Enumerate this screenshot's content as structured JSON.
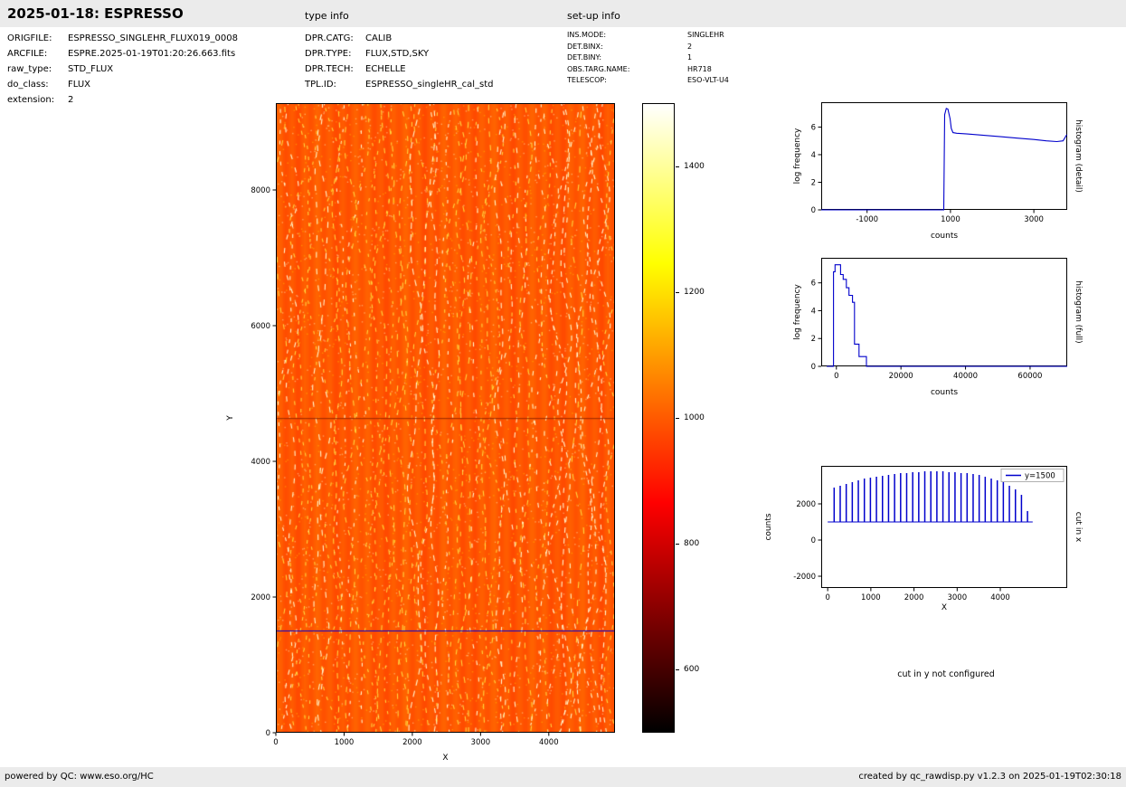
{
  "header": {
    "title": "2025-01-18: ESPRESSO",
    "type_info_heading": "type info",
    "setup_info_heading": "set-up info"
  },
  "file_info": {
    "rows": [
      {
        "label": "ORIGFILE:",
        "value": "ESPRESSO_SINGLEHR_FLUX019_0008"
      },
      {
        "label": "ARCFILE:",
        "value": "ESPRE.2025-01-19T01:20:26.663.fits"
      },
      {
        "label": "raw_type:",
        "value": "STD_FLUX"
      },
      {
        "label": "do_class:",
        "value": "FLUX"
      },
      {
        "label": "extension:",
        "value": "2"
      }
    ]
  },
  "type_info": {
    "rows": [
      {
        "label": "DPR.CATG:",
        "value": "CALIB"
      },
      {
        "label": "DPR.TYPE:",
        "value": "FLUX,STD,SKY"
      },
      {
        "label": "DPR.TECH:",
        "value": "ECHELLE"
      },
      {
        "label": "TPL.ID:",
        "value": "ESPRESSO_singleHR_cal_std"
      }
    ]
  },
  "setup_info": {
    "rows": [
      {
        "label": "INS.MODE:",
        "value": "SINGLEHR"
      },
      {
        "label": "DET.BINX:",
        "value": "2"
      },
      {
        "label": "DET.BINY:",
        "value": "1"
      },
      {
        "label": "OBS.TARG.NAME:",
        "value": "HR718"
      },
      {
        "label": "TELESCOP:",
        "value": "ESO-VLT-U4"
      }
    ]
  },
  "notes": {
    "cut_in_y": "cut in y not configured"
  },
  "footer": {
    "left": "powered by QC: www.eso.org/HC",
    "right": "created by qc_rawdisp.py v1.2.3 on 2025-01-19T02:30:18"
  },
  "colors": {
    "line_blue": "#0000cc",
    "strip_gray": "#ebebeb",
    "image_base_orange": "#ff5a00"
  },
  "chart_data": [
    {
      "type": "heatmap",
      "name": "raw-echelle-image",
      "xlabel": "X",
      "ylabel": "Y",
      "xlim": [
        0,
        4970
      ],
      "ylim": [
        0,
        9280
      ],
      "xticks": [
        0,
        1000,
        2000,
        3000,
        4000
      ],
      "yticks": [
        0,
        2000,
        4000,
        6000,
        8000
      ],
      "colormap": "hot",
      "base_counts": 1000,
      "cut_line_y": 1500,
      "detector_gap_y": 4640,
      "colorbar": {
        "ticks": [
          600,
          800,
          1000,
          1200,
          1400
        ],
        "range": [
          500,
          1500
        ]
      }
    },
    {
      "type": "line",
      "name": "histogram-detail",
      "right_label": "histogram (detail)",
      "xlabel": "counts",
      "ylabel": "log frequency",
      "xlim": [
        -2100,
        3800
      ],
      "ylim": [
        0,
        7.8
      ],
      "xticks": [
        -1000,
        1000,
        3000
      ],
      "yticks": [
        0,
        2,
        4,
        6
      ],
      "series": [
        {
          "name": "pixel-value-histogram-detail",
          "x": [
            -2100,
            840,
            860,
            900,
            940,
            990,
            1020,
            1060,
            1150,
            1400,
            1800,
            2200,
            2600,
            3000,
            3300,
            3550,
            3700,
            3790
          ],
          "y": [
            0,
            0,
            6.9,
            7.35,
            7.3,
            6.6,
            5.9,
            5.6,
            5.55,
            5.5,
            5.4,
            5.3,
            5.2,
            5.1,
            5.0,
            4.95,
            5.0,
            5.45
          ]
        }
      ]
    },
    {
      "type": "line",
      "name": "histogram-full",
      "right_label": "histogram (full)",
      "xlabel": "counts",
      "ylabel": "log frequency",
      "xlim": [
        -4700,
        71500
      ],
      "ylim": [
        0,
        7.8
      ],
      "xticks": [
        0,
        20000,
        40000,
        60000
      ],
      "yticks": [
        0,
        2,
        4,
        6
      ],
      "series": [
        {
          "name": "pixel-value-histogram-full",
          "x": [
            -3000,
            -900,
            -900,
            -400,
            -400,
            1300,
            1300,
            2100,
            2100,
            3100,
            3100,
            3900,
            3900,
            5000,
            5000,
            5600,
            5600,
            7000,
            7000,
            9300,
            9300,
            71500
          ],
          "y": [
            0,
            0,
            6.8,
            6.8,
            7.3,
            7.3,
            6.6,
            6.6,
            6.25,
            6.25,
            5.65,
            5.65,
            5.1,
            5.1,
            4.6,
            4.6,
            1.6,
            1.6,
            0.7,
            0.7,
            0,
            0
          ]
        }
      ]
    },
    {
      "type": "line",
      "name": "cut-in-x",
      "right_label": "cut in x",
      "xlabel": "X",
      "ylabel": "counts",
      "xlim": [
        -150,
        5550
      ],
      "ylim": [
        -2650,
        4100
      ],
      "xticks": [
        0,
        1000,
        2000,
        3000,
        4000
      ],
      "yticks": [
        -2000,
        0,
        2000
      ],
      "legend": {
        "label": "y=1500",
        "loc": "upper right"
      },
      "spikes": {
        "baseline": 1000,
        "baseline_span": [
          0,
          4750
        ],
        "positions": [
          150,
          290,
          430,
          570,
          710,
          850,
          990,
          1130,
          1270,
          1410,
          1550,
          1690,
          1830,
          1970,
          2110,
          2250,
          2390,
          2530,
          2670,
          2810,
          2950,
          3090,
          3230,
          3370,
          3510,
          3650,
          3790,
          3930,
          4070,
          4210,
          4350,
          4490,
          4630
        ],
        "heights": [
          2900,
          3000,
          3100,
          3200,
          3300,
          3400,
          3450,
          3500,
          3550,
          3600,
          3650,
          3700,
          3700,
          3750,
          3750,
          3800,
          3800,
          3800,
          3800,
          3750,
          3750,
          3700,
          3700,
          3650,
          3600,
          3500,
          3400,
          3300,
          3200,
          3000,
          2800,
          2500,
          1600
        ]
      }
    }
  ]
}
